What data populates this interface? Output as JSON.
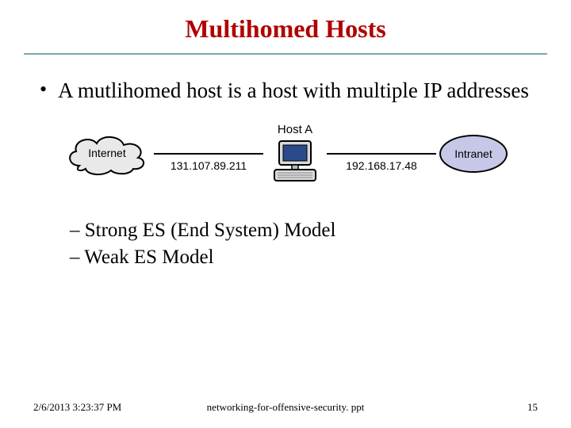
{
  "title": "Multihomed Hosts",
  "bullet": "A mutlihomed host is a host with multiple IP addresses",
  "diagram": {
    "left_label": "Internet",
    "host_label": "Host A",
    "right_label": "Intranet",
    "ip_left": "131.107.89.211",
    "ip_right": "192.168.17.48"
  },
  "sublist": {
    "item1": "– Strong ES (End System) Model",
    "item2": "– Weak ES Model"
  },
  "footer": {
    "date": "2/6/2013 3:23:37 PM",
    "file": "networking-for-offensive-security. ppt",
    "page": "15"
  }
}
